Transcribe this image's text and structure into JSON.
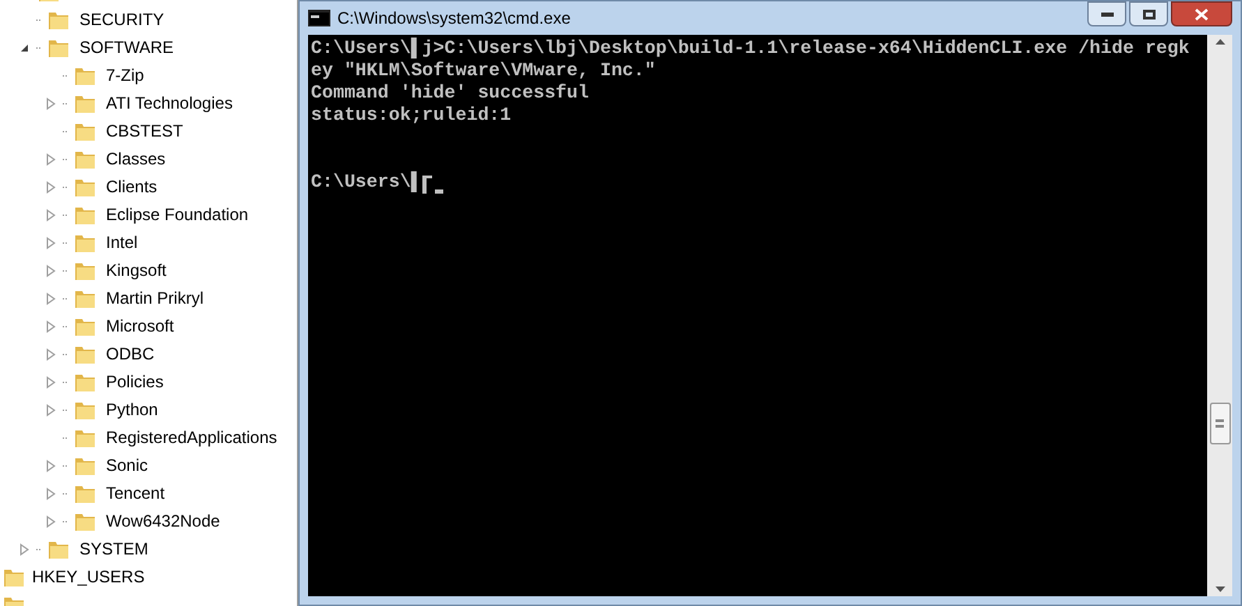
{
  "registry_tree": [
    {
      "label": "SECURITY",
      "has_children": false
    },
    {
      "label": "SOFTWARE",
      "has_children": true,
      "expanded": true,
      "children": [
        {
          "label": "7-Zip",
          "has_children": false
        },
        {
          "label": "ATI Technologies",
          "has_children": true,
          "expanded": false
        },
        {
          "label": "CBSTEST",
          "has_children": false
        },
        {
          "label": "Classes",
          "has_children": true,
          "expanded": false
        },
        {
          "label": "Clients",
          "has_children": true,
          "expanded": false
        },
        {
          "label": "Eclipse Foundation",
          "has_children": true,
          "expanded": false
        },
        {
          "label": "Intel",
          "has_children": true,
          "expanded": false
        },
        {
          "label": "Kingsoft",
          "has_children": true,
          "expanded": false
        },
        {
          "label": "Martin Prikryl",
          "has_children": true,
          "expanded": false
        },
        {
          "label": "Microsoft",
          "has_children": true,
          "expanded": false
        },
        {
          "label": "ODBC",
          "has_children": true,
          "expanded": false
        },
        {
          "label": "Policies",
          "has_children": true,
          "expanded": false
        },
        {
          "label": "Python",
          "has_children": true,
          "expanded": false
        },
        {
          "label": "RegisteredApplications",
          "has_children": false
        },
        {
          "label": "Sonic",
          "has_children": true,
          "expanded": false
        },
        {
          "label": "Tencent",
          "has_children": true,
          "expanded": false
        },
        {
          "label": "Wow6432Node",
          "has_children": true,
          "expanded": false
        }
      ]
    },
    {
      "label": "SYSTEM",
      "has_children": true,
      "expanded": false
    }
  ],
  "root_keys": [
    {
      "label": "HKEY_USERS"
    }
  ],
  "console_window": {
    "title": "C:\\Windows\\system32\\cmd.exe",
    "lines": [
      "C:\\Users\\▌j>C:\\Users\\lbj\\Desktop\\build-1.1\\release-x64\\HiddenCLI.exe /hide regk",
      "ey \"HKLM\\Software\\VMware, Inc.\"",
      "Command 'hide' successful",
      "status:ok;ruleid:1"
    ],
    "prompt": "C:\\Users\\▌"
  }
}
